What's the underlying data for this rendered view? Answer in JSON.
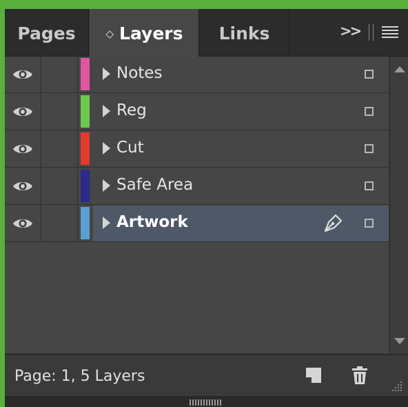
{
  "tabs": {
    "pages": "Pages",
    "layers": "Layers",
    "links": "Links",
    "layers_arrows": "◇",
    "collapse": ">>"
  },
  "layers": [
    {
      "name": "Notes",
      "color": "#e0569f",
      "visible": true,
      "selected": false
    },
    {
      "name": "Reg",
      "color": "#6cc94e",
      "visible": true,
      "selected": false
    },
    {
      "name": "Cut",
      "color": "#e53a2c",
      "visible": true,
      "selected": false
    },
    {
      "name": "Safe Area",
      "color": "#2a2a8a",
      "visible": true,
      "selected": false
    },
    {
      "name": "Artwork",
      "color": "#5b9fd3",
      "visible": true,
      "selected": true
    }
  ],
  "footer": {
    "status": "Page: 1, 5 Layers"
  },
  "icons": {
    "eye": "eye-icon",
    "pen": "pen-nib-icon",
    "new_layer": "new-layer-icon",
    "trash": "trash-icon",
    "panel_menu": "panel-menu-icon"
  },
  "colors": {
    "frame": "#5ab03c",
    "panel_bg": "#464646",
    "selected_row": "#4e5867"
  }
}
